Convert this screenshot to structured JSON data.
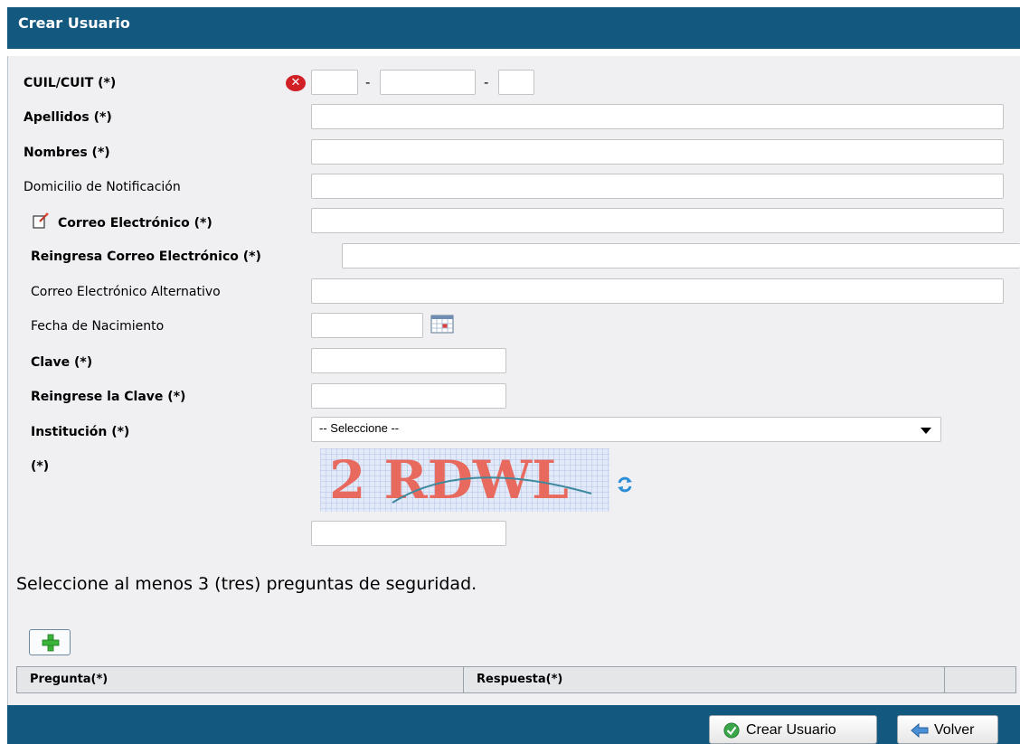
{
  "header": {
    "title": "Crear Usuario"
  },
  "form": {
    "cuil_label": "CUIL/CUIT (*)",
    "cuil_sep1": "-",
    "cuil_sep2": "-",
    "apellidos_label": "Apellidos (*)",
    "nombres_label": "Nombres (*)",
    "domicilio_label": "Domicilio de Notificación",
    "correo_label": "Correo Electrónico (*)",
    "reingresa_correo_label": "Reingresa Correo Electrónico (*)",
    "correo_alt_label": "Correo Electrónico Alternativo",
    "fecha_label": "Fecha de Nacimiento",
    "clave_label": "Clave (*)",
    "reingrese_clave_label": "Reingrese la Clave (*)",
    "institucion_label": "Institución (*)",
    "institucion_value": "-- Seleccione --",
    "captcha_label": "(*)",
    "captcha_text": "2 RDWL"
  },
  "security": {
    "instructions": "Seleccione al menos 3 (tres) preguntas de seguridad.",
    "columns": [
      "Pregunta(*)",
      "Respuesta(*)",
      ""
    ]
  },
  "footer": {
    "create_label": "Crear Usuario",
    "back_label": "Volver"
  },
  "colors": {
    "header_bg": "#12587f",
    "panel_bg": "#f0f0f2",
    "error_red": "#d11f26",
    "add_green": "#3bb33b"
  },
  "icons": [
    "error-x-icon",
    "note-edit-icon",
    "calendar-icon",
    "refresh-icon",
    "plus-icon",
    "check-icon",
    "back-arrow-icon",
    "chevron-down-icon"
  ]
}
